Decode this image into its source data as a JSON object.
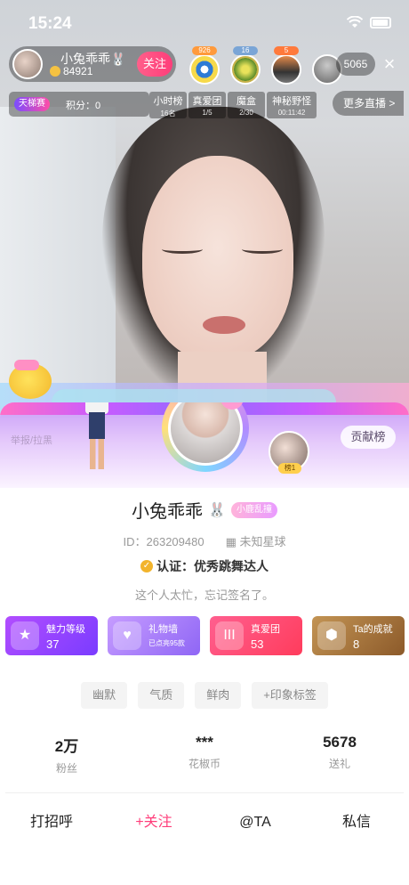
{
  "status_bar": {
    "time": "15:24"
  },
  "host": {
    "name": "小兔乖乖🐰",
    "coins": "84921",
    "follow_label": "关注"
  },
  "viewers": {
    "badges": [
      "926",
      "16",
      "5"
    ],
    "count": "5065",
    "close_label": "×"
  },
  "rank": {
    "tag": "天梯赛",
    "score_label": "积分：0"
  },
  "stats_bar": [
    {
      "title": "小时榜",
      "sub": "16名"
    },
    {
      "title": "真爱团",
      "sub": "1/5"
    },
    {
      "title": "魔盒",
      "sub": "2/30"
    },
    {
      "title": "神秘野怪",
      "sub": "00:11:42"
    }
  ],
  "more_live": "更多直播 >",
  "profile": {
    "report_label": "举报/拉黑",
    "contrib_label": "贡献榜",
    "mini_avatar_tag": "榜1",
    "name": "小兔乖乖",
    "tag": "小鹿乱撞",
    "id_label": "ID：263209480",
    "location": "未知星球",
    "cert_label": "认证：优秀跳舞达人",
    "bio": "这个人太忙，忘记签名了。"
  },
  "badges": [
    {
      "label": "魅力等级",
      "value": "37",
      "icon": "star"
    },
    {
      "label": "礼物墙",
      "sub": "已点亮95款",
      "icon": "heart"
    },
    {
      "label": "真爱团",
      "value": "53",
      "icon": "III"
    },
    {
      "label": "Ta的成就",
      "value": "8",
      "icon": "medal"
    }
  ],
  "impressions": [
    "幽默",
    "气质",
    "鲜肉",
    "+印象标签"
  ],
  "stats": [
    {
      "value": "2万",
      "label": "粉丝"
    },
    {
      "value": "***",
      "label": "花椒币"
    },
    {
      "value": "5678",
      "label": "送礼"
    }
  ],
  "actions": [
    "打招呼",
    "+关注",
    "@TA",
    "私信"
  ],
  "colors": {
    "accent": "#ff3d7a",
    "gold": "#f2b42c"
  }
}
